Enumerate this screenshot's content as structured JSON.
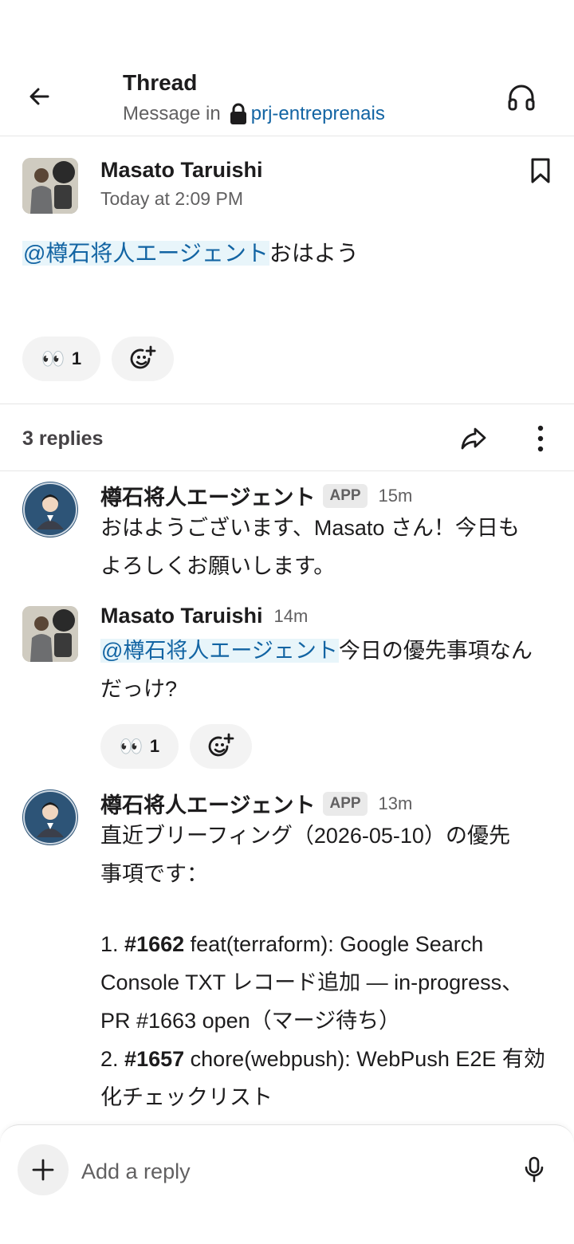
{
  "header": {
    "title": "Thread",
    "subtitle_prefix": "Message in",
    "channel": "prj-entreprenais"
  },
  "parent": {
    "author": "Masato Taruishi",
    "time": "Today at 2:09 PM",
    "mention": "@樽石将人エージェント",
    "text": "おはよう",
    "reaction": {
      "emoji": "👀",
      "count": "1"
    }
  },
  "replies_bar": {
    "label": "3 replies"
  },
  "replies": [
    {
      "author": "樽石将人エージェント",
      "badge": "APP",
      "time": "15m",
      "text_line1": "おはようございます、Masato さん！今日も",
      "text_line2": "よろしくお願いします。"
    },
    {
      "author": "Masato Taruishi",
      "time": "14m",
      "mention": "@樽石将人エージェント",
      "text_line1": "今日の優先事項なん",
      "text_line2": "だっけ?",
      "reaction": {
        "emoji": "👀",
        "count": "1"
      }
    },
    {
      "author": "樽石将人エージェント",
      "badge": "APP",
      "time": "13m",
      "intro_line1": "直近ブリーフィング（2026-05-10）の優先",
      "intro_line2": "事項です：",
      "item1_num": "1.",
      "item1_issue": "#1662",
      "item1_line1": "feat(terraform): Google Search",
      "item1_line2": "Console TXT レコード追加 — in-progress、",
      "item1_line3": "PR #1663 open（マージ待ち）",
      "item2_num": "2.",
      "item2_issue": "#1657",
      "item2_line1": "chore(webpush): WebPush E2E 有効",
      "item2_line2": "化チェックリスト"
    }
  ],
  "composer": {
    "placeholder": "Add a reply"
  },
  "icons": {
    "back": "arrow-left-icon",
    "lock": "lock-icon",
    "headphones": "headphones-icon",
    "bookmark": "bookmark-icon",
    "add_reaction": "add-reaction-icon",
    "share": "share-icon",
    "more": "more-vertical-icon",
    "plus": "plus-icon",
    "mic": "microphone-icon"
  },
  "colors": {
    "link": "#1264a3",
    "mention_bg": "#e8f5fa",
    "text": "#1d1c1d",
    "muted": "#616061"
  }
}
